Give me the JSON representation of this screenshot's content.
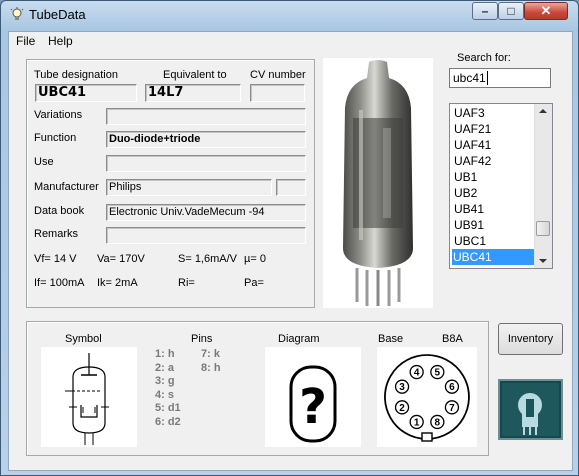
{
  "window": {
    "title": "TubeData",
    "icons": [
      "bulb-icon",
      "minimize-icon",
      "maximize-icon",
      "close-icon"
    ]
  },
  "menu": {
    "file": "File",
    "help": "Help"
  },
  "headers": {
    "designation": "Tube designation",
    "equivalent": "Equivalent to",
    "cv": "CV number"
  },
  "values": {
    "designation": "UBC41",
    "equivalent": "14L7",
    "cv": ""
  },
  "fields": {
    "variations_label": "Variations",
    "variations": "",
    "function_label": "Function",
    "function": "Duo-diode+triode",
    "use_label": "Use",
    "use": "",
    "manufacturer_label": "Manufacturer",
    "manufacturer": "Philips",
    "manufacturer_extra": "",
    "databook_label": "Data book",
    "databook": "Electronic Univ.VadeMecum -94",
    "remarks_label": "Remarks",
    "remarks": ""
  },
  "params": {
    "vf": "Vf= 14 V",
    "va": "Va=  170V",
    "s": "S= 1,6mA/V",
    "mu": "µ=    0",
    "if": "If= 100mA",
    "ik": "Ik=   2mA",
    "ri": "Ri=",
    "pa": "Pa="
  },
  "search": {
    "label": "Search for:",
    "value": "ubc41"
  },
  "tube_list": [
    "UAF3",
    "UAF21",
    "UAF41",
    "UAF42",
    "UB1",
    "UB2",
    "UB41",
    "UB91",
    "UBC1",
    "UBC41"
  ],
  "tube_list_selected": "UBC41",
  "bottom": {
    "symbol_label": "Symbol",
    "pins_label": "Pins",
    "diagram_label": "Diagram",
    "base_label": "Base",
    "base_type": "B8A",
    "diagram_mark": "?",
    "pins_col1": [
      "1: h",
      "2: a",
      "3: g",
      "4: s",
      "5: d1",
      "6: d2"
    ],
    "pins_col2": [
      "7: k",
      "8: h"
    ],
    "base_pins": [
      "1",
      "2",
      "3",
      "4",
      "5",
      "6",
      "7",
      "8"
    ]
  },
  "buttons": {
    "inventory": "Inventory"
  },
  "colors": {
    "selection": "#3399ff",
    "window_frame": "#a9c6e2",
    "logo_bg": "#17474c"
  }
}
